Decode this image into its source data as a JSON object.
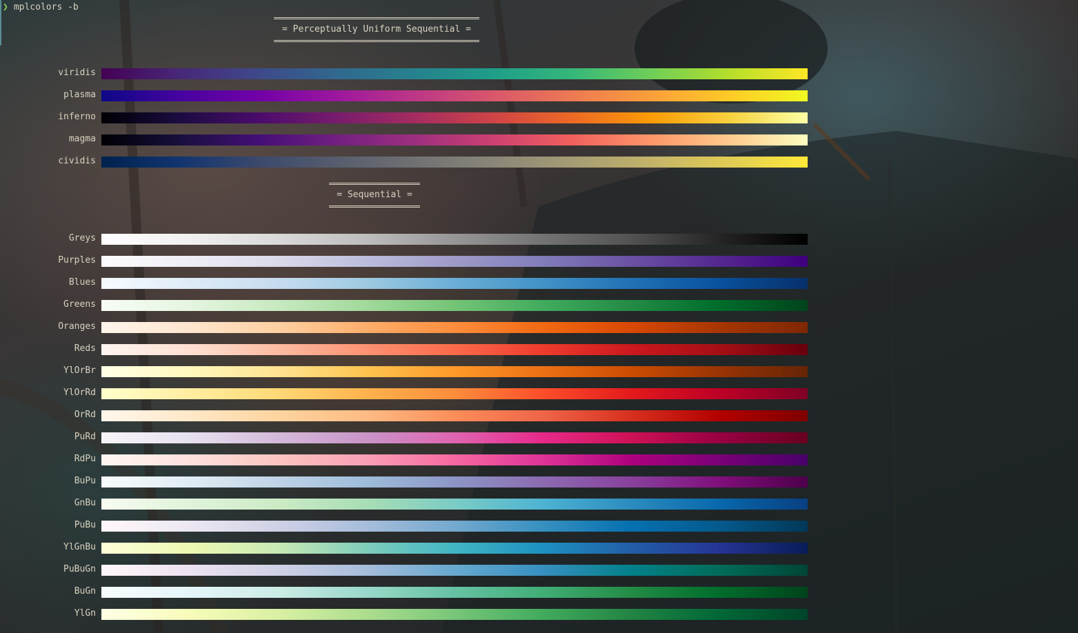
{
  "terminal": {
    "prompt_symbol": "❯",
    "command": "mplcolors -b"
  },
  "sections": [
    {
      "title": "= Perceptually Uniform Sequential =",
      "colormaps": [
        {
          "name": "viridis",
          "colors": [
            "#440154",
            "#482878",
            "#3e4989",
            "#31688e",
            "#26828e",
            "#1f9e89",
            "#35b779",
            "#6ece58",
            "#b5de2b",
            "#fde725"
          ]
        },
        {
          "name": "plasma",
          "colors": [
            "#0d0887",
            "#46039f",
            "#7201a8",
            "#9c179e",
            "#bd3786",
            "#d8576b",
            "#ed7953",
            "#fb9f3a",
            "#fdca26",
            "#f0f921"
          ]
        },
        {
          "name": "inferno",
          "colors": [
            "#000004",
            "#1b0c41",
            "#4a0c6b",
            "#781c6d",
            "#a52c60",
            "#cf4446",
            "#ed6925",
            "#fb9b06",
            "#f7d13d",
            "#fcffa4"
          ]
        },
        {
          "name": "magma",
          "colors": [
            "#000004",
            "#180f3d",
            "#440f76",
            "#721f81",
            "#9e2f7f",
            "#cd4071",
            "#f1605d",
            "#fd9668",
            "#feca8d",
            "#fcfdbf"
          ]
        },
        {
          "name": "cividis",
          "colors": [
            "#00224e",
            "#123570",
            "#3b496c",
            "#575d6d",
            "#707173",
            "#8a8678",
            "#a59c74",
            "#c3b369",
            "#e1cc55",
            "#fee838"
          ]
        }
      ]
    },
    {
      "title": "= Sequential =",
      "colormaps": [
        {
          "name": "Greys",
          "colors": [
            "#ffffff",
            "#f0f0f0",
            "#d9d9d9",
            "#bdbdbd",
            "#969696",
            "#737373",
            "#525252",
            "#252525",
            "#000000"
          ]
        },
        {
          "name": "Purples",
          "colors": [
            "#fcfbfd",
            "#efedf5",
            "#dadaeb",
            "#bcbddc",
            "#9e9ac8",
            "#807dba",
            "#6a51a3",
            "#54278f",
            "#3f007d"
          ]
        },
        {
          "name": "Blues",
          "colors": [
            "#f7fbff",
            "#deebf7",
            "#c6dbef",
            "#9ecae1",
            "#6baed6",
            "#4292c6",
            "#2171b5",
            "#08519c",
            "#08306b"
          ]
        },
        {
          "name": "Greens",
          "colors": [
            "#f7fcf5",
            "#e5f5e0",
            "#c7e9c0",
            "#a1d99b",
            "#74c476",
            "#41ab5d",
            "#238b45",
            "#006d2c",
            "#00441b"
          ]
        },
        {
          "name": "Oranges",
          "colors": [
            "#fff5eb",
            "#fee6ce",
            "#fdd0a2",
            "#fdae6b",
            "#fd8d3c",
            "#f16913",
            "#d94801",
            "#a63603",
            "#7f2704"
          ]
        },
        {
          "name": "Reds",
          "colors": [
            "#fff5f0",
            "#fee0d2",
            "#fcbba1",
            "#fc9272",
            "#fb6a4a",
            "#ef3b2c",
            "#cb181d",
            "#a50f15",
            "#67000d"
          ]
        },
        {
          "name": "YlOrBr",
          "colors": [
            "#ffffe5",
            "#fff7bc",
            "#fee391",
            "#fec44f",
            "#fe9929",
            "#ec7014",
            "#cc4c02",
            "#993404",
            "#662506"
          ]
        },
        {
          "name": "YlOrRd",
          "colors": [
            "#ffffcc",
            "#ffeda0",
            "#fed976",
            "#feb24c",
            "#fd8d3c",
            "#fc4e2a",
            "#e31a1c",
            "#bd0026",
            "#800026"
          ]
        },
        {
          "name": "OrRd",
          "colors": [
            "#fff7ec",
            "#fee8c8",
            "#fdd49e",
            "#fdbb84",
            "#fc8d59",
            "#ef6548",
            "#d7301f",
            "#b30000",
            "#7f0000"
          ]
        },
        {
          "name": "PuRd",
          "colors": [
            "#f7f4f9",
            "#e7e1ef",
            "#d4b9da",
            "#c994c7",
            "#df65b0",
            "#e7298a",
            "#ce1256",
            "#980043",
            "#67001f"
          ]
        },
        {
          "name": "RdPu",
          "colors": [
            "#fff7f3",
            "#fde0dd",
            "#fcc5c0",
            "#fa9fb5",
            "#f768a1",
            "#dd3497",
            "#ae017e",
            "#7a0177",
            "#49006a"
          ]
        },
        {
          "name": "BuPu",
          "colors": [
            "#f7fcfd",
            "#e0ecf4",
            "#bfd3e6",
            "#9ebcda",
            "#8c96c6",
            "#8c6bb1",
            "#88419d",
            "#810f7c",
            "#4d004b"
          ]
        },
        {
          "name": "GnBu",
          "colors": [
            "#f7fcf0",
            "#e0f3db",
            "#ccebc5",
            "#a8ddb5",
            "#7bccc4",
            "#4eb3d3",
            "#2b8cbe",
            "#0868ac",
            "#084081"
          ]
        },
        {
          "name": "PuBu",
          "colors": [
            "#fff7fb",
            "#ece7f2",
            "#d0d1e6",
            "#a6bddb",
            "#74a9cf",
            "#3690c0",
            "#0570b0",
            "#045a8d",
            "#023858"
          ]
        },
        {
          "name": "YlGnBu",
          "colors": [
            "#ffffd9",
            "#edf8b1",
            "#c7e9b4",
            "#7fcdbb",
            "#41b6c4",
            "#1d91c0",
            "#225ea8",
            "#253494",
            "#081d58"
          ]
        },
        {
          "name": "PuBuGn",
          "colors": [
            "#fff7fb",
            "#ece2f0",
            "#d0d1e6",
            "#a6bddb",
            "#67a9cf",
            "#3690c0",
            "#02818a",
            "#016c59",
            "#014636"
          ]
        },
        {
          "name": "BuGn",
          "colors": [
            "#f7fcfd",
            "#e5f5f9",
            "#ccece6",
            "#99d8c9",
            "#66c2a4",
            "#41ae76",
            "#238b45",
            "#006d2c",
            "#00441b"
          ]
        },
        {
          "name": "YlGn",
          "colors": [
            "#ffffe5",
            "#f7fcb9",
            "#d9f0a3",
            "#addd8e",
            "#78c679",
            "#41ab5d",
            "#238443",
            "#006837",
            "#004529"
          ]
        }
      ]
    }
  ]
}
